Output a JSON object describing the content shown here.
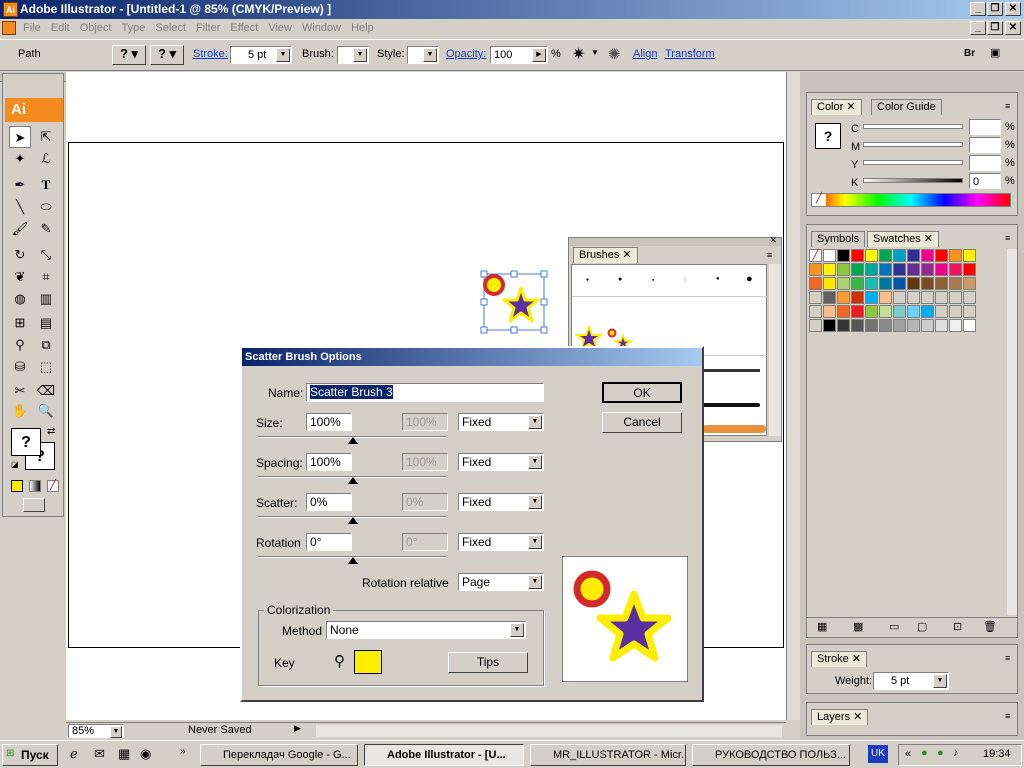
{
  "window": {
    "title": "Adobe Illustrator - [Untitled-1 @ 85% (CMYK/Preview) ]"
  },
  "menu": [
    "File",
    "Edit",
    "Object",
    "Type",
    "Select",
    "Filter",
    "Effect",
    "View",
    "Window",
    "Help"
  ],
  "control": {
    "selection_label": "Path",
    "stroke_label": "Stroke:",
    "stroke_value": "5 pt",
    "brush_label": "Brush:",
    "style_label": "Style:",
    "opacity_label": "Opacity:",
    "opacity_value": "100",
    "percent": "%",
    "align_label": "Align",
    "transform_label": "Transform",
    "br_label": "Br"
  },
  "tools": {
    "app_badge": "Ai"
  },
  "brushes_panel": {
    "tab": "Brushes"
  },
  "color_panel": {
    "tabs": [
      "Color",
      "Color Guide"
    ],
    "channels": [
      {
        "label": "C",
        "value": ""
      },
      {
        "label": "M",
        "value": ""
      },
      {
        "label": "Y",
        "value": ""
      },
      {
        "label": "K",
        "value": "0"
      }
    ],
    "percent": "%"
  },
  "swatches_panel": {
    "tabs": [
      "Symbols",
      "Swatches"
    ]
  },
  "stroke_panel": {
    "tab": "Stroke",
    "weight_label": "Weight:",
    "weight_value": "5 pt"
  },
  "layers_panel": {
    "tab": "Layers"
  },
  "status": {
    "zoom": "85%",
    "status_text": "Never Saved"
  },
  "dialog": {
    "title": "Scatter Brush Options",
    "name_label": "Name:",
    "name_value": "Scatter Brush 3",
    "ok": "OK",
    "cancel": "Cancel",
    "rows": [
      {
        "label": "Size:",
        "value": "100%",
        "value2": "100%",
        "mode": "Fixed"
      },
      {
        "label": "Spacing:",
        "value": "100%",
        "value2": "100%",
        "mode": "Fixed"
      },
      {
        "label": "Scatter:",
        "value": "0%",
        "value2": "0%",
        "mode": "Fixed"
      },
      {
        "label": "Rotation",
        "value": "0°",
        "value2": "0°",
        "mode": "Fixed"
      }
    ],
    "rotation_relative_label": "Rotation relative",
    "rotation_relative_value": "Page",
    "colorization_label": "Colorization",
    "method_label": "Method",
    "method_value": "None",
    "key_label": "Key",
    "key_color": "#ffee00",
    "tips_label": "Tips"
  },
  "taskbar": {
    "start": "Пуск",
    "tasks": [
      "Перекладач Google - G...",
      "Adobe Illustrator - [U...",
      "MR_ILLUSTRATOR - Micr...",
      "РУКОВОДСТВО ПОЛЬЗ..."
    ],
    "lang": "UK",
    "clock": "19:34"
  },
  "colors": {
    "star_fill": "#5a2fa0",
    "star_outline": "#ffee00",
    "circle_outer": "#d42a2a",
    "circle_inner": "#ffee00",
    "accent": "#f58a1f"
  }
}
